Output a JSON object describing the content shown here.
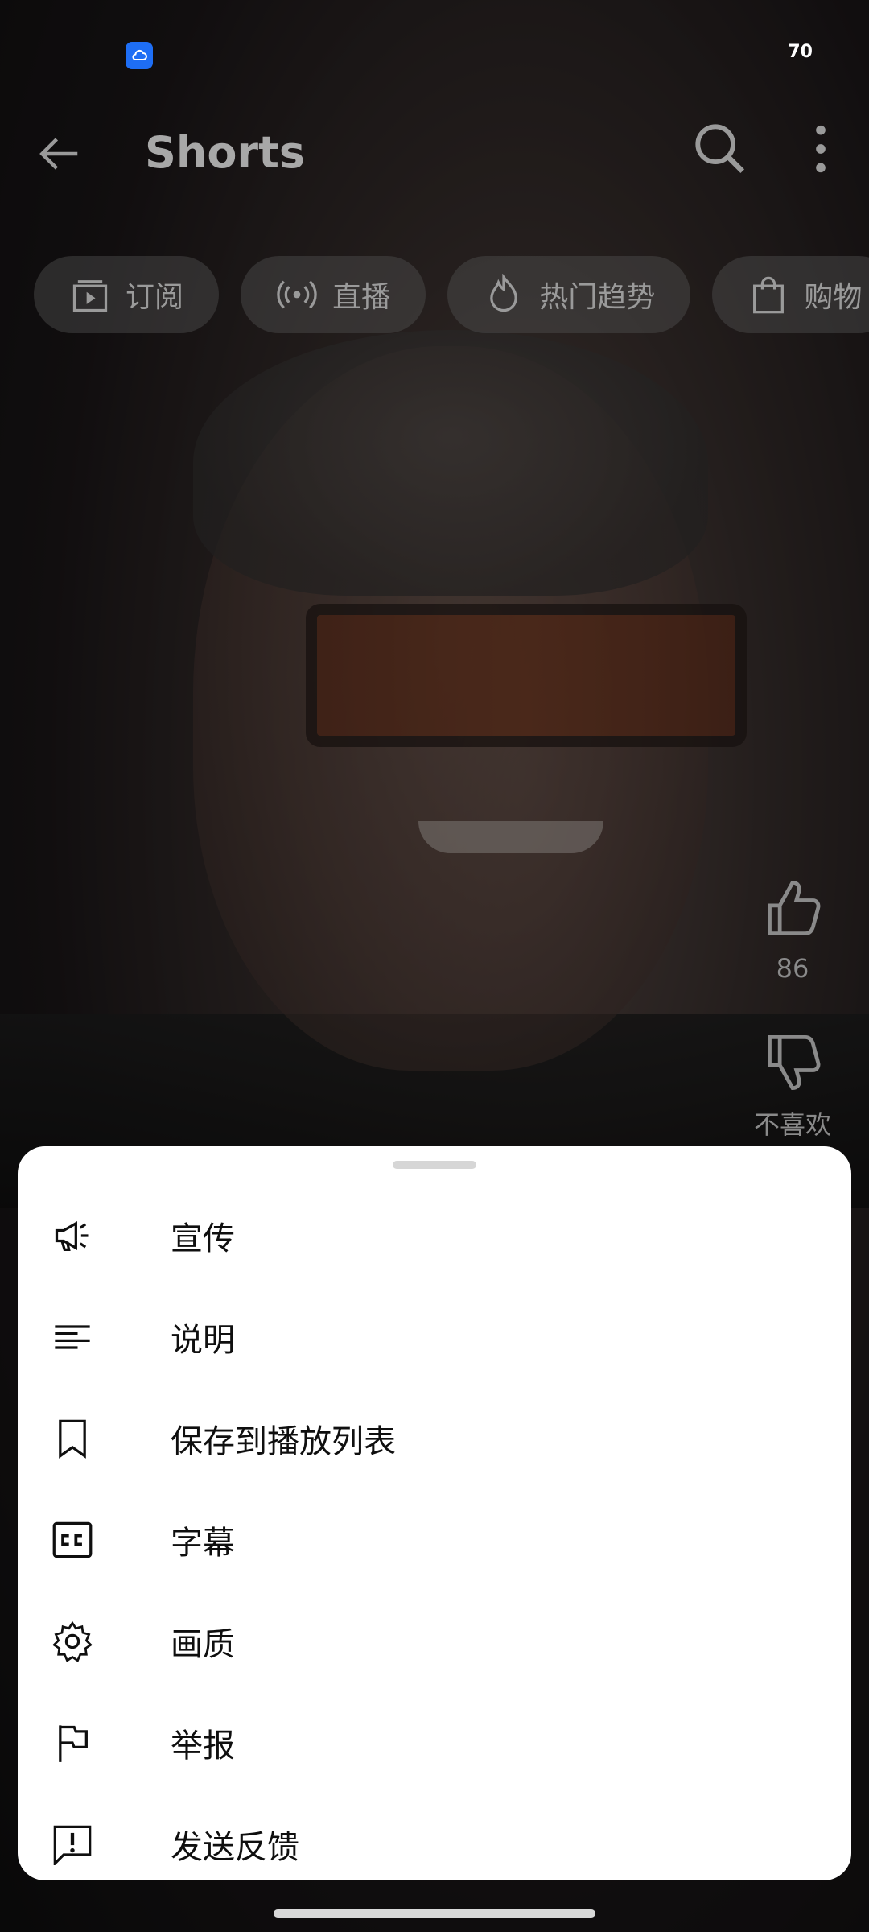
{
  "status_bar": {
    "battery": "70"
  },
  "top_bar": {
    "title": "Shorts"
  },
  "chips": [
    {
      "label": "订阅",
      "icon": "subscriptions-icon"
    },
    {
      "label": "直播",
      "icon": "live-icon"
    },
    {
      "label": "热门趋势",
      "icon": "trending-icon"
    },
    {
      "label": "购物",
      "icon": "shopping-bag-icon"
    }
  ],
  "rail": {
    "like_count": "86",
    "dislike_label": "不喜欢"
  },
  "sheet": {
    "items": [
      {
        "label": "宣传",
        "icon": "megaphone-icon"
      },
      {
        "label": "说明",
        "icon": "description-icon"
      },
      {
        "label": "保存到播放列表",
        "icon": "bookmark-icon"
      },
      {
        "label": "字幕",
        "icon": "captions-icon"
      },
      {
        "label": "画质",
        "icon": "settings-gear-icon"
      },
      {
        "label": "举报",
        "icon": "flag-icon"
      },
      {
        "label": "发送反馈",
        "icon": "feedback-icon"
      }
    ]
  },
  "colors": {
    "sheet_background": "#ffffff",
    "status_badge": "#1e6ef5"
  }
}
